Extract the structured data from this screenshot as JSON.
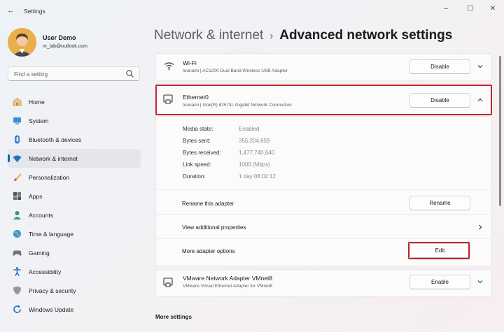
{
  "window": {
    "title": "Settings",
    "back_glyph": "←",
    "controls": {
      "minimize": "–",
      "maximize": "☐",
      "close": "✕"
    }
  },
  "user": {
    "name": "User Demo",
    "email": "m_lab@outlook.com"
  },
  "search": {
    "placeholder": "Find a setting"
  },
  "sidebar": {
    "items": [
      {
        "label": "Home",
        "icon": "home-icon"
      },
      {
        "label": "System",
        "icon": "system-icon"
      },
      {
        "label": "Bluetooth & devices",
        "icon": "bluetooth-icon"
      },
      {
        "label": "Network & internet",
        "icon": "wifi-icon",
        "active": true
      },
      {
        "label": "Personalization",
        "icon": "brush-icon"
      },
      {
        "label": "Apps",
        "icon": "apps-icon"
      },
      {
        "label": "Accounts",
        "icon": "accounts-icon"
      },
      {
        "label": "Time & language",
        "icon": "globe-icon"
      },
      {
        "label": "Gaming",
        "icon": "gaming-icon"
      },
      {
        "label": "Accessibility",
        "icon": "accessibility-icon"
      },
      {
        "label": "Privacy & security",
        "icon": "shield-icon"
      },
      {
        "label": "Windows Update",
        "icon": "update-icon"
      }
    ]
  },
  "breadcrumb": {
    "parent": "Network & internet",
    "separator": "›",
    "current": "Advanced network settings"
  },
  "adapters": {
    "wifi": {
      "name": "Wi-Fi",
      "description": "tounami | AC1200 Dual Band Wireless USB Adapter",
      "button": "Disable"
    },
    "ethernet": {
      "name": "Ethernet0",
      "description": "tounami | Intel(R) 82574L Gigabit Network Connection",
      "button": "Disable",
      "properties": [
        {
          "label": "Media state:",
          "value": "Enabled"
        },
        {
          "label": "Bytes sent:",
          "value": "355,204,659"
        },
        {
          "label": "Bytes received:",
          "value": "1,477,740,640"
        },
        {
          "label": "Link speed:",
          "value": "1000 (Mbps)"
        },
        {
          "label": "Duration:",
          "value": "1 day 08:02:12"
        }
      ],
      "rename_label": "Rename this adapter",
      "rename_button": "Rename",
      "view_props_label": "View additional properties",
      "more_options_label": "More adapter options",
      "edit_button": "Edit"
    },
    "vmware": {
      "name": "VMware Network Adapter VMnet8",
      "description": "VMware Virtual Ethernet Adapter for VMnet8",
      "button": "Enable"
    }
  },
  "more_settings": {
    "title": "More settings"
  },
  "colors": {
    "accent": "#0067c0",
    "highlight": "#c0262d"
  }
}
